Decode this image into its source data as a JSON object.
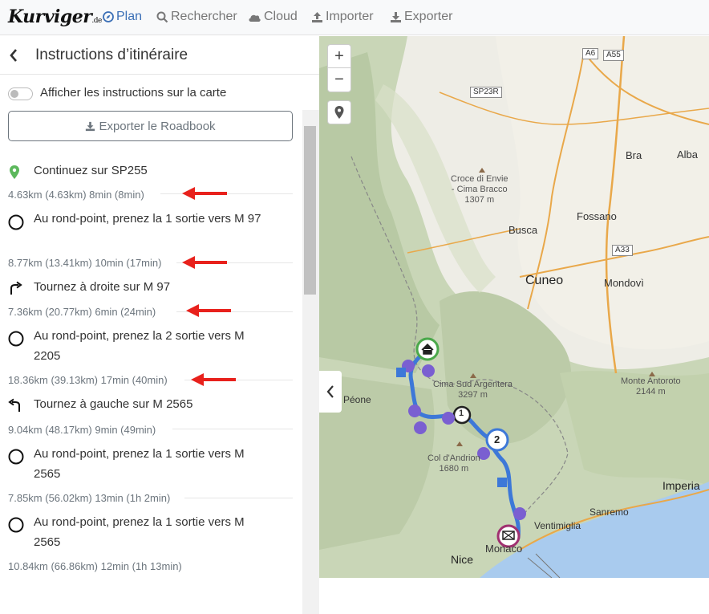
{
  "brand": {
    "logo": "Kurviger",
    "logo_suffix": ".de"
  },
  "nav": {
    "plan": "Plan",
    "search": "Rechercher",
    "cloud": "Cloud",
    "import": "Importer",
    "export": "Exporter"
  },
  "panel": {
    "title": "Instructions d’itinéraire",
    "toggle_label": "Afficher les instructions sur la carte",
    "export_label": "Exporter le Roadbook"
  },
  "steps": [
    {
      "icon": "map-pin",
      "text": "Continuez sur SP255",
      "dist": "4.63km (4.63km) 8min (8min)"
    },
    {
      "icon": "roundabout",
      "text": "Au rond-point, prenez la 1 sortie vers M 97",
      "dist": "8.77km (13.41km) 10min (17min)"
    },
    {
      "icon": "turn-right",
      "text": "Tournez à droite sur M 97",
      "dist": "7.36km (20.77km) 6min (24min)"
    },
    {
      "icon": "roundabout",
      "text": "Au rond-point, prenez la 2 sortie vers M 2205",
      "dist": "18.36km (39.13km) 17min (40min)"
    },
    {
      "icon": "turn-left",
      "text": "Tournez à gauche sur M 2565",
      "dist": "9.04km (48.17km) 9min (49min)"
    },
    {
      "icon": "roundabout",
      "text": "Au rond-point, prenez la 1 sortie vers M 2565",
      "dist": "7.85km (56.02km) 13min (1h 2min)"
    },
    {
      "icon": "roundabout",
      "text": "Au rond-point, prenez la 1 sortie vers M 2565",
      "dist": "10.84km (66.86km) 12min (1h 13min)"
    }
  ],
  "map": {
    "zoom_in": "+",
    "zoom_out": "−",
    "labels": {
      "a6": "A6",
      "a55": "A55",
      "sp23r": "SP23R",
      "a33": "A33",
      "bra": "Bra",
      "alba": "Alba",
      "croce": "Croce di Envie\n- Cima Bracco\n1307 m",
      "busca": "Busca",
      "fossano": "Fossano",
      "cuneo": "Cuneo",
      "mondovi": "Mondovì",
      "cima_sud": "Cima Sud Argentera\n3297 m",
      "monte_antoroto": "Monte Antoroto\n2144 m",
      "peone": "Péone",
      "col": "Col d'Andrion\n1680 m",
      "imperia": "Imperia",
      "sanremo": "Sanremo",
      "ventimiglia": "Ventimiglia",
      "nice": "Nice",
      "monaco": "Monaco"
    },
    "waypoint_1": "1",
    "waypoint_2": "2"
  },
  "colors": {
    "accent": "#3b6fb6",
    "route": "#3d78d8",
    "arrow": "#e8211c",
    "sea": "#a9cbee"
  }
}
